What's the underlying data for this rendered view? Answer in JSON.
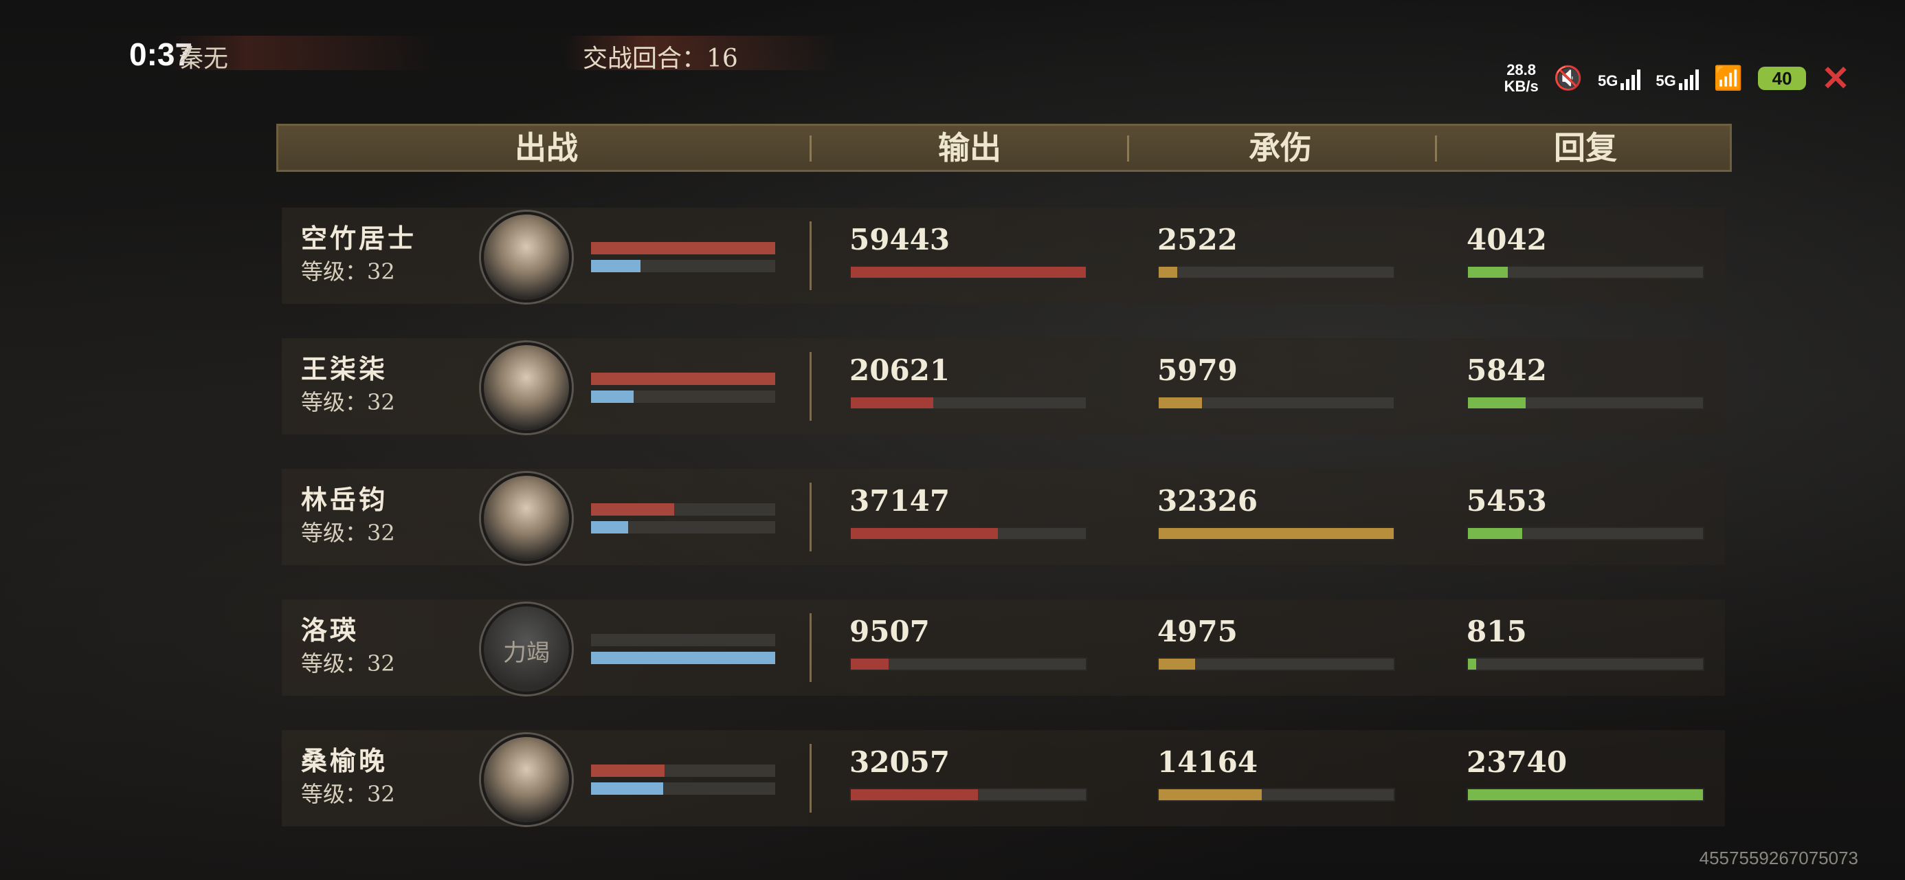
{
  "status": {
    "clock": "0:37",
    "netspeed_value": "28.8",
    "netspeed_unit": "KB/s",
    "sim1": "5G",
    "sim2": "5G",
    "battery": "40"
  },
  "topbar": {
    "left_text": "秦无",
    "round_label": "交战回合：16"
  },
  "columns": {
    "sortie": "出战",
    "output": "输出",
    "tank": "承伤",
    "heal": "回复"
  },
  "rows": [
    {
      "name": "空竹居士",
      "level": "等级：32",
      "hp": 1.0,
      "mp": 0.27,
      "output": "59443",
      "output_ratio": 1.0,
      "tank": "2522",
      "tank_ratio": 0.078,
      "heal": "4042",
      "heal_ratio": 0.17,
      "avatar_label": ""
    },
    {
      "name": "王柒柒",
      "level": "等级：32",
      "hp": 1.0,
      "mp": 0.23,
      "output": "20621",
      "output_ratio": 0.35,
      "tank": "5979",
      "tank_ratio": 0.185,
      "heal": "5842",
      "heal_ratio": 0.246,
      "avatar_label": ""
    },
    {
      "name": "林岳钧",
      "level": "等级：32",
      "hp": 0.45,
      "mp": 0.2,
      "output": "37147",
      "output_ratio": 0.625,
      "tank": "32326",
      "tank_ratio": 1.0,
      "heal": "5453",
      "heal_ratio": 0.23,
      "avatar_label": ""
    },
    {
      "name": "洛瑛",
      "level": "等级：32",
      "hp": 0.0,
      "mp": 1.0,
      "output": "9507",
      "output_ratio": 0.16,
      "tank": "4975",
      "tank_ratio": 0.154,
      "heal": "815",
      "heal_ratio": 0.034,
      "avatar_label": "力竭"
    },
    {
      "name": "桑榆晚",
      "level": "等级：32",
      "hp": 0.4,
      "mp": 0.39,
      "output": "32057",
      "output_ratio": 0.54,
      "tank": "14164",
      "tank_ratio": 0.44,
      "heal": "23740",
      "heal_ratio": 1.0,
      "avatar_label": ""
    }
  ],
  "uid": "4557559267075073"
}
